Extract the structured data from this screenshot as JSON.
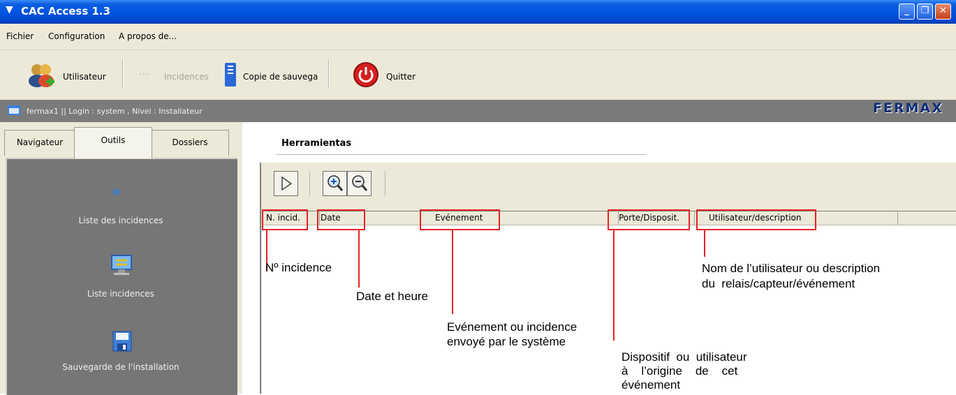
{
  "window": {
    "title": "CAC Access 1.3",
    "minimize": "_",
    "maximize": "❐",
    "close": "✕"
  },
  "menu": [
    "Fichier",
    "Configuration",
    "A propos de..."
  ],
  "toolbar": {
    "user_label": "Utilisateur",
    "incidences_label": "Incidences",
    "backup_label": "Copie de sauvega",
    "quit_label": "Quitter"
  },
  "status": {
    "text": "fermax1  || Login : system , Nivel : Installateur",
    "brand": "FERMAX"
  },
  "tabs": [
    "Navigateur",
    "Outils",
    "Dossiers"
  ],
  "nav_items": [
    {
      "label": "Liste des incidences",
      "icon": "double-chevron-icon"
    },
    {
      "label": "Liste incidences",
      "icon": "monitor-arrows-icon"
    },
    {
      "label": "Sauvegarde de l'installation",
      "icon": "floppy-disk-icon"
    }
  ],
  "panel_title": "Herramientas",
  "columns": [
    "N. incid.",
    "Date",
    "Evénement",
    "Porte/Disposit.",
    "Utilisateur/description"
  ],
  "annotations": {
    "incid": "Nº incidence",
    "date": "Date et heure",
    "event_1": "Evénement ou incidence",
    "event_2": "envoyé par le système",
    "porte_1": "Dispositif  ou  utilisateur",
    "porte_2": "à    l’origine    de    cet",
    "porte_3": "événement",
    "user_1": "Nom de l’utilisateur ou description",
    "user_2": "du  relais/capteur/événement"
  },
  "colors": {
    "titlebar": "#0055e3",
    "panel": "#767676",
    "highlight": "#e52323"
  }
}
